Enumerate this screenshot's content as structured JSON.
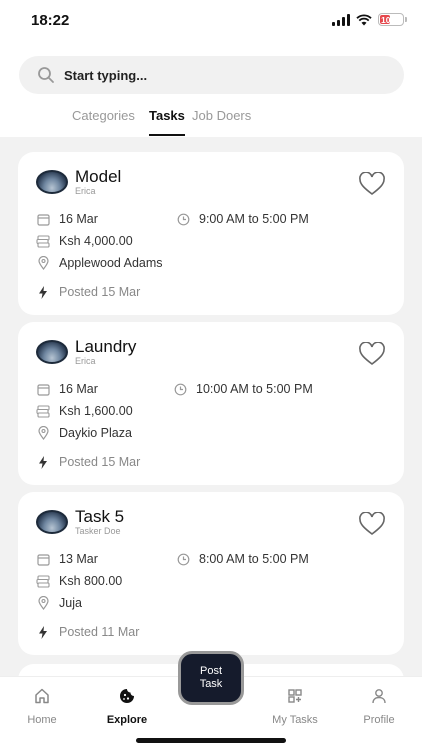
{
  "status_bar": {
    "time": "18:22",
    "battery": "10"
  },
  "search": {
    "placeholder": "Start typing..."
  },
  "tabs": [
    {
      "label": "Categories",
      "active": false
    },
    {
      "label": "Tasks",
      "active": true
    },
    {
      "label": "Job Doers",
      "active": false
    }
  ],
  "tasks": [
    {
      "title": "Model",
      "author": "Erica",
      "date": "16 Mar",
      "time": "9:00 AM to 5:00 PM",
      "price": "Ksh 4,000.00",
      "location": "Applewood Adams",
      "posted": "Posted 15 Mar"
    },
    {
      "title": "Laundry",
      "author": "Erica",
      "date": "16 Mar",
      "time": "10:00 AM to 5:00 PM",
      "price": "Ksh 1,600.00",
      "location": "Daykio Plaza",
      "posted": "Posted 15 Mar"
    },
    {
      "title": "Task 5",
      "author": "Tasker Doe",
      "date": "13 Mar",
      "time": "8:00 AM to 5:00 PM",
      "price": "Ksh 800.00",
      "location": "Juja",
      "posted": "Posted 11 Mar"
    }
  ],
  "fab": {
    "line1": "Post",
    "line2": "Task"
  },
  "nav": [
    {
      "label": "Home",
      "icon": "home-icon",
      "active": false
    },
    {
      "label": "Explore",
      "icon": "explore-icon",
      "active": true
    },
    {
      "label": "My Tasks",
      "icon": "my-tasks-icon",
      "active": false
    },
    {
      "label": "Profile",
      "icon": "profile-icon",
      "active": false
    }
  ],
  "colors": {
    "accent": "#151b2c",
    "battery_low": "#e5484d",
    "background": "#f2f2f2"
  }
}
